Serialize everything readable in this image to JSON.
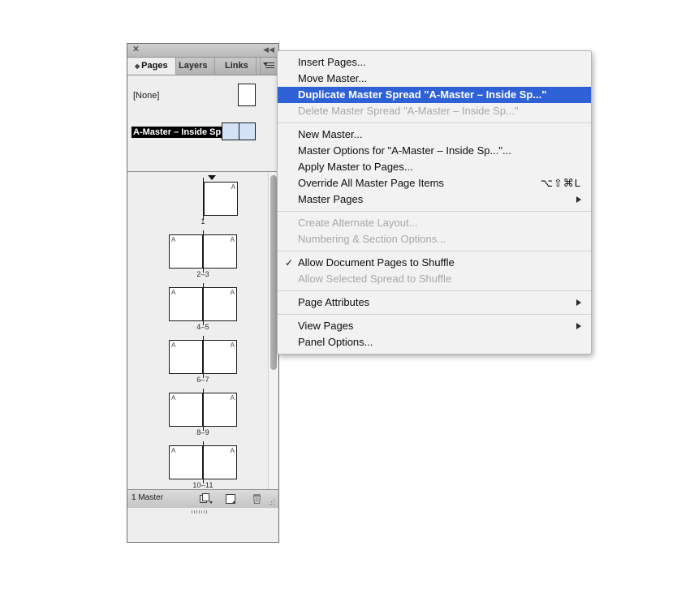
{
  "panel": {
    "close_icon": "close-icon",
    "collapse_icon": "collapse-icon",
    "tabs": [
      {
        "label": "Pages",
        "active": true
      },
      {
        "label": "Layers",
        "active": false
      },
      {
        "label": "Links",
        "active": false
      }
    ],
    "panel_menu_icon": "panel-menu-icon",
    "masters": [
      {
        "label": "[None]",
        "selected": false,
        "type": "single"
      },
      {
        "label": "A-Master – Inside Spread",
        "selected": true,
        "type": "spread"
      }
    ],
    "spreads": [
      {
        "label": "1",
        "pages": [
          "A"
        ],
        "type": "single-right",
        "marker": true
      },
      {
        "label": "2–3",
        "pages": [
          "A",
          "A"
        ],
        "type": "spread",
        "marker": false
      },
      {
        "label": "4–5",
        "pages": [
          "A",
          "A"
        ],
        "type": "spread",
        "marker": false
      },
      {
        "label": "6–7",
        "pages": [
          "A",
          "A"
        ],
        "type": "spread",
        "marker": false
      },
      {
        "label": "8–9",
        "pages": [
          "A",
          "A"
        ],
        "type": "spread",
        "marker": false
      },
      {
        "label": "10–11",
        "pages": [
          "A",
          "A"
        ],
        "type": "spread",
        "marker": false
      }
    ],
    "footer": {
      "count_label": "1 Master",
      "new_master_icon": "new-master-icon",
      "new_page_icon": "new-page-icon",
      "delete_icon": "trash-icon",
      "resize_grip_icon": "resize-grip-icon"
    }
  },
  "menu": {
    "groups": [
      {
        "items": [
          {
            "label": "Insert Pages...",
            "state": "normal"
          },
          {
            "label": "Move Master...",
            "state": "normal"
          },
          {
            "label": "Duplicate Master Spread \"A-Master – Inside Sp...\"",
            "state": "selected"
          },
          {
            "label": "Delete Master Spread \"A-Master – Inside Sp...\"",
            "state": "disabled"
          }
        ]
      },
      {
        "items": [
          {
            "label": "New Master...",
            "state": "normal"
          },
          {
            "label": "Master Options for \"A-Master – Inside Sp...\"...",
            "state": "normal"
          },
          {
            "label": "Apply Master to Pages...",
            "state": "normal"
          },
          {
            "label": "Override All Master Page Items",
            "state": "normal",
            "shortcut": "⌥⇧⌘L"
          },
          {
            "label": "Master Pages",
            "state": "normal",
            "submenu": true
          }
        ]
      },
      {
        "items": [
          {
            "label": "Create Alternate Layout...",
            "state": "disabled"
          },
          {
            "label": "Numbering & Section Options...",
            "state": "disabled"
          }
        ]
      },
      {
        "items": [
          {
            "label": "Allow Document Pages to Shuffle",
            "state": "normal",
            "checked": true
          },
          {
            "label": "Allow Selected Spread to Shuffle",
            "state": "disabled"
          }
        ]
      },
      {
        "items": [
          {
            "label": "Page Attributes",
            "state": "normal",
            "submenu": true
          }
        ]
      },
      {
        "items": [
          {
            "label": "View Pages",
            "state": "normal",
            "submenu": true
          },
          {
            "label": "Panel Options...",
            "state": "normal"
          }
        ]
      }
    ]
  },
  "colors": {
    "selection_blue": "#2f61d6",
    "master_thumb_blue": "#d3e3f5",
    "panel_bg": "#eeeeee",
    "menu_bg": "#f2f2f2"
  }
}
